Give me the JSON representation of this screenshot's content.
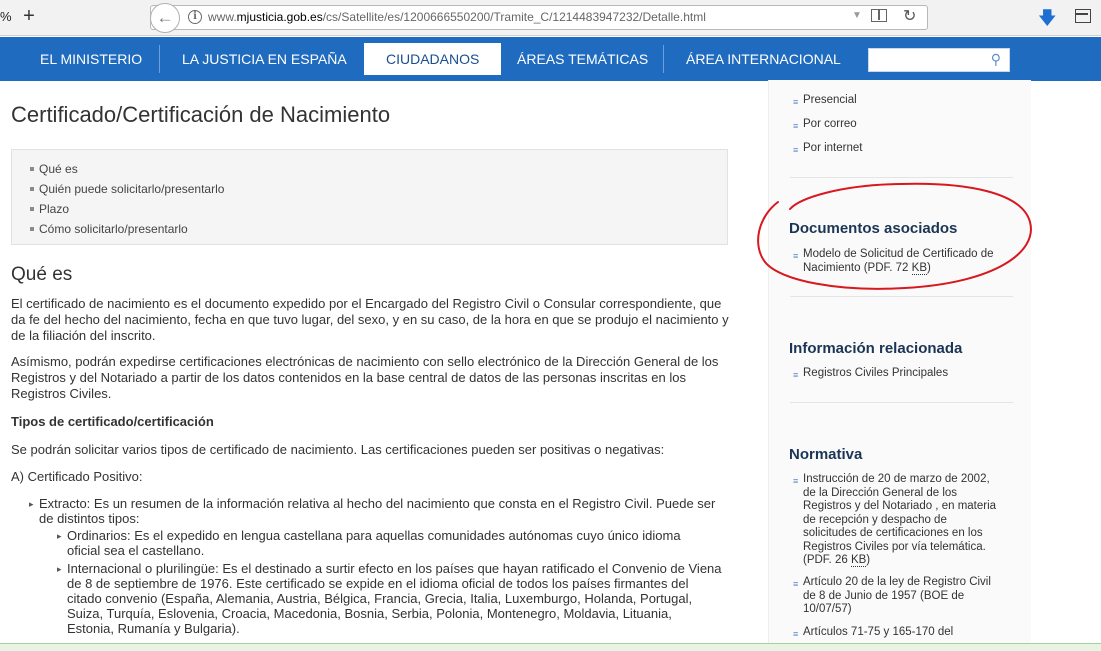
{
  "browser": {
    "tab_stub": "%",
    "new_tab": "+",
    "url_prefix": "www.",
    "url_domain": "mjusticia.gob.es",
    "url_path": "/cs/Satellite/es/1200666550200/Tramite_C/1214483947232/Detalle.html"
  },
  "nav": {
    "items": [
      "EL MINISTERIO",
      "LA JUSTICIA EN ESPAÑA",
      "CIUDADANOS",
      "ÁREAS TEMÁTICAS",
      "ÁREA INTERNACIONAL"
    ],
    "active_index": 2,
    "search_placeholder": ""
  },
  "main": {
    "title": "Certificado/Certificación de Nacimiento",
    "toc": [
      "Qué es",
      "Quién puede solicitarlo/presentarlo",
      "Plazo",
      "Cómo solicitarlo/presentarlo"
    ],
    "section_title": "Qué es",
    "p1": "El certificado de nacimiento es el documento expedido por el Encargado del Registro Civil o Consular correspondiente, que da fe del hecho del nacimiento, fecha en que tuvo lugar, del sexo, y en su caso, de la hora en que se produjo el nacimiento y de la filiación del inscrito.",
    "p2": "Asímismo, podrán expedirse certificaciones electrónicas de nacimiento con sello electrónico de la  Dirección General de los Registros y del Notariado a partir de los datos contenidos en la base central de datos de las personas inscritas en los Registros Civiles.",
    "tipos_title": "Tipos de certificado/certificación",
    "p3": "Se podrán solicitar varios tipos de certificado de nacimiento. Las certificaciones pueden ser positivas o negativas:",
    "p4": "A) Certificado Positivo:",
    "b1": "Extracto: Es un resumen de la información relativa al hecho del nacimiento que consta en el Registro Civil. Puede ser de distintos tipos:",
    "b2": "Ordinarios: Es el expedido en lengua castellana para aquellas comunidades autónomas cuyo único idioma oficial sea el castellano.",
    "b3": "Internacional o plurilingüe: Es el destinado a surtir efecto en los países que hayan ratificado el Convenio de Viena de 8 de septiembre de 1976. Este certificado se expide en el idioma oficial de todos los países firmantes del citado convenio (España, Alemania, Austria, Bélgica, Francia, Grecia, Italia, Luxemburgo, Holanda, Portugal, Suiza, Turquía, Eslovenia, Croacia, Macedonia, Bosnia, Serbia, Polonia, Montenegro, Moldavia, Lituania, Estonia, Rumanía y Bulgaria)."
  },
  "sidebar": {
    "channels": [
      "Presencial",
      "Por correo",
      "Por internet"
    ],
    "docs_title": "Documentos asociados",
    "doc_link": "Modelo de Solicitud de Certificado de Nacimiento (PDF. 72 ",
    "doc_kb": "KB",
    "doc_close": ")",
    "info_title": "Información relacionada",
    "info_link": "Registros Civiles Principales",
    "norm_title": "Normativa",
    "norm1": "Instrucción de 20 de marzo de 2002, de la Dirección General de los Registros y del Notariado , en materia de recepción y despacho de solicitudes de certificaciones en los Registros Civiles por vía telemática. (PDF. 26 ",
    "norm1_kb": "KB",
    "norm1_close": ")",
    "norm2": "Artículo 20 de la ley de Registro Civil de 8 de Junio de 1957 (BOE de 10/07/57)",
    "norm3": "Artículos 71-75 y 165-170 del"
  },
  "colors": {
    "nav_bg": "#1f6bbf",
    "annotation": "#d8171e",
    "sidebar_title": "#1b3554"
  }
}
